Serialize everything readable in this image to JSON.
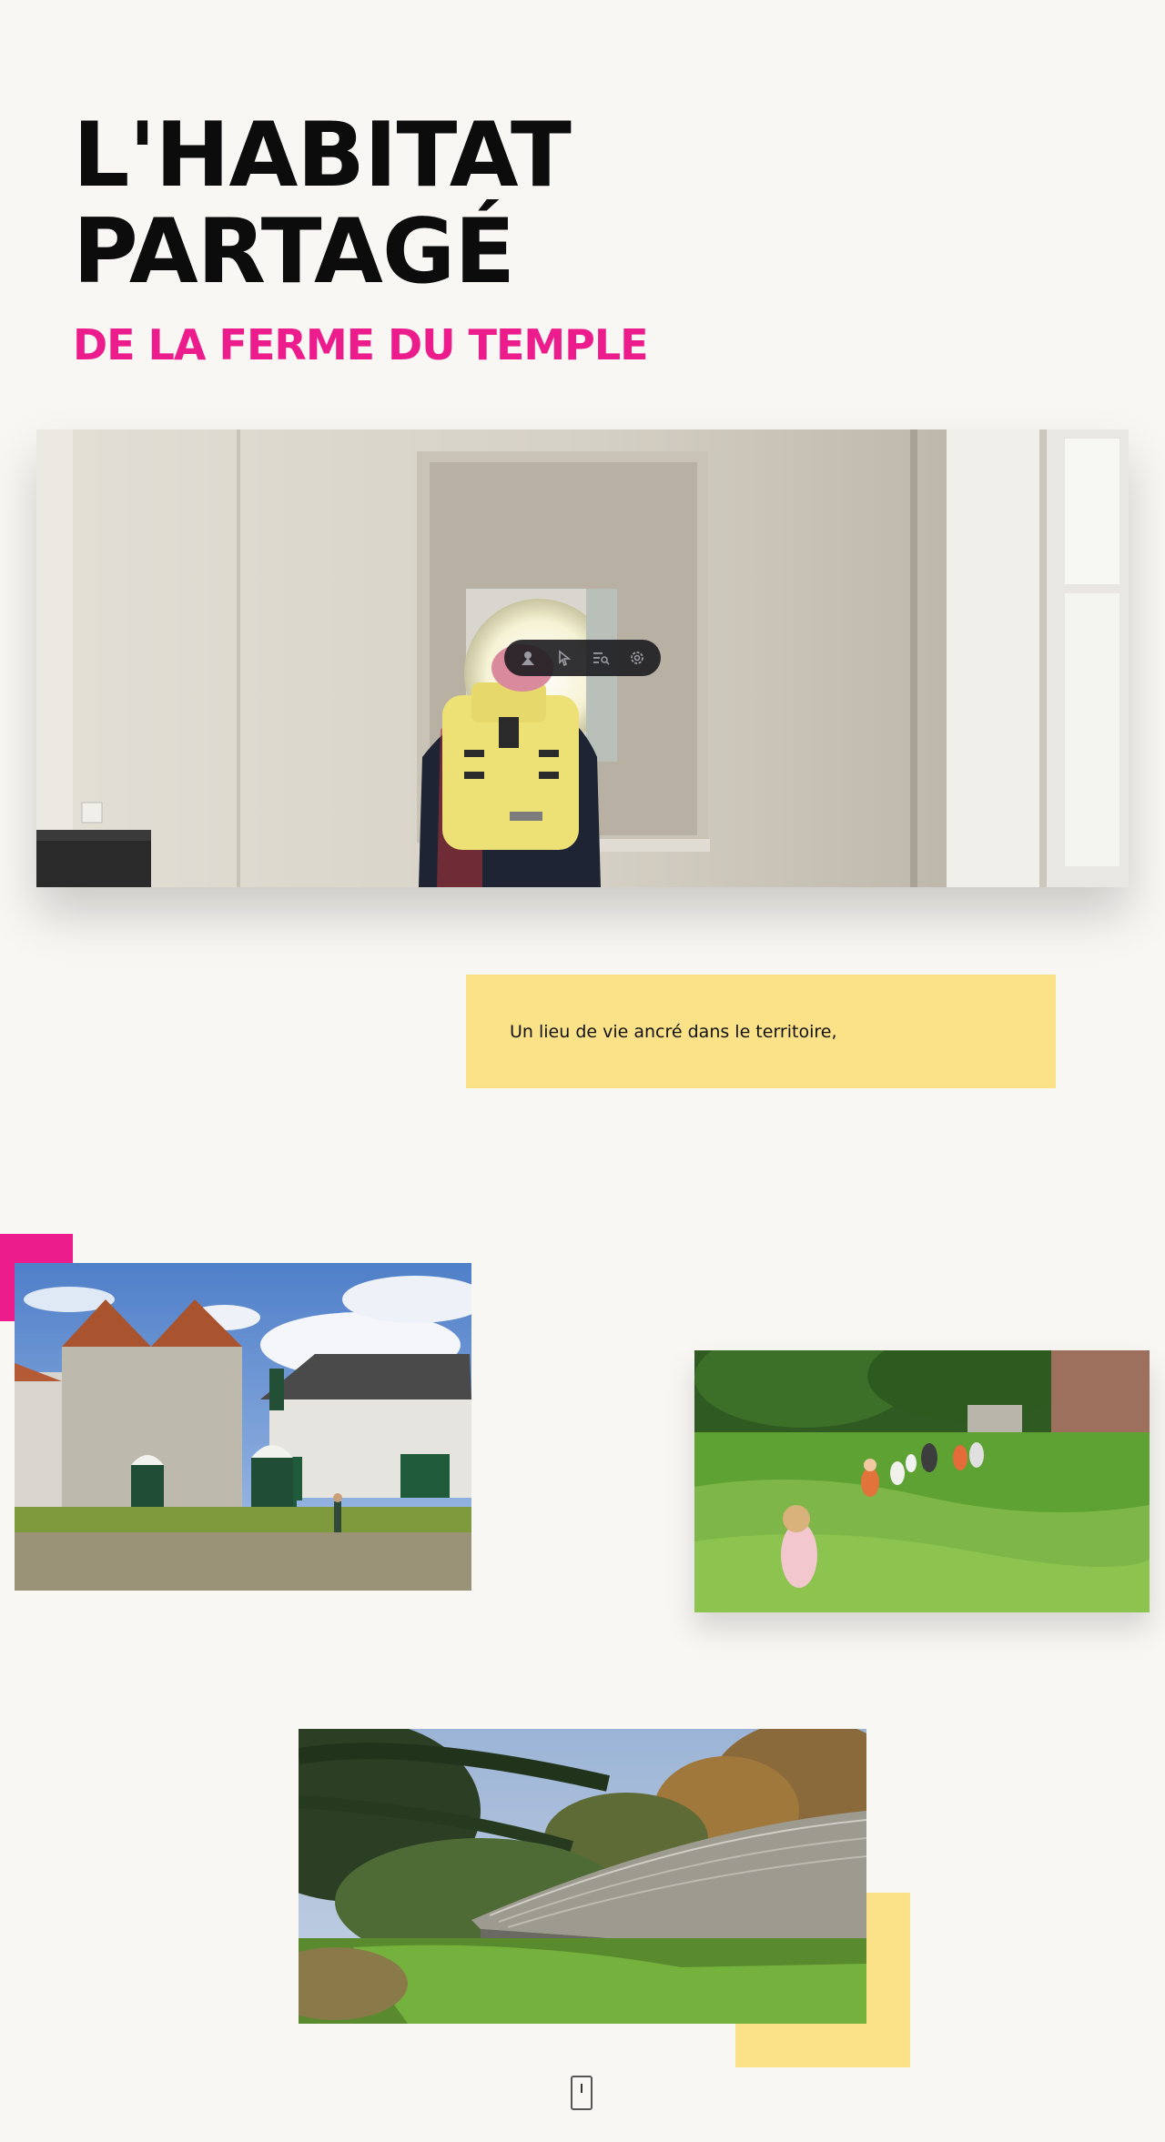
{
  "header": {
    "title_line1": "L'HABITAT",
    "title_line2": "PARTAGÉ",
    "subtitle": "DE LA FERME DU TEMPLE"
  },
  "toolbar": {
    "icons": [
      "user-icon",
      "pointer-icon",
      "list-search-icon",
      "settings-icon"
    ]
  },
  "callout": {
    "text": "Un lieu de vie ancré dans le territoire,"
  },
  "colors": {
    "background": "#f9f7f4",
    "accent_pink": "#ec1c8c",
    "accent_yellow": "#fbe288",
    "title": "#0c0c0c"
  }
}
